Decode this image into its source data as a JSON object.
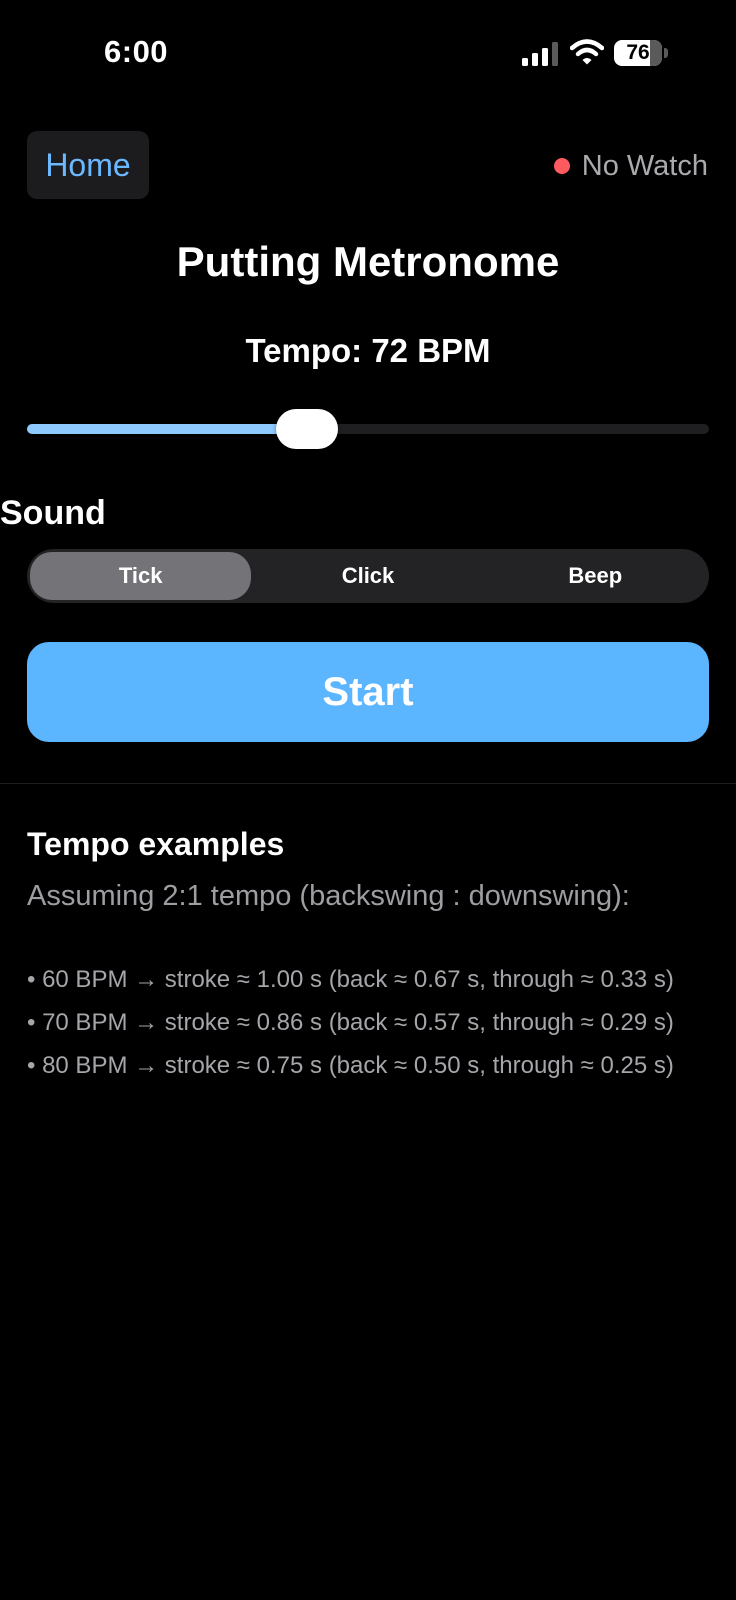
{
  "status_bar": {
    "time": "6:00",
    "battery_percent": "76",
    "icons": [
      "signal-icon",
      "wifi-icon",
      "battery-icon"
    ]
  },
  "header": {
    "home_label": "Home",
    "watch_status_label": "No Watch",
    "watch_status_color": "#ff5a5f"
  },
  "title": "Putting Metronome",
  "tempo": {
    "label": "Tempo: 72 BPM",
    "slider_fraction": 0.41
  },
  "sound": {
    "heading": "Sound",
    "options": [
      "Tick",
      "Click",
      "Beep"
    ],
    "selected": "Tick"
  },
  "start_label": "Start",
  "examples": {
    "heading": "Tempo examples",
    "intro": "Assuming 2:1 tempo (backswing : downswing):",
    "items": [
      "• 60 BPM → stroke ≈ 1.00 s  (back ≈ 0.67 s, through ≈ 0.33 s)",
      "• 70 BPM → stroke ≈ 0.86 s  (back ≈ 0.57 s, through ≈ 0.29 s)",
      "• 80 BPM → stroke ≈ 0.75 s  (back ≈ 0.50 s, through ≈ 0.25 s)"
    ]
  },
  "colors": {
    "accent": "#5cb5ff",
    "link": "#6cb8ff",
    "slider_fill": "#8ec9ff",
    "background": "#000000"
  }
}
